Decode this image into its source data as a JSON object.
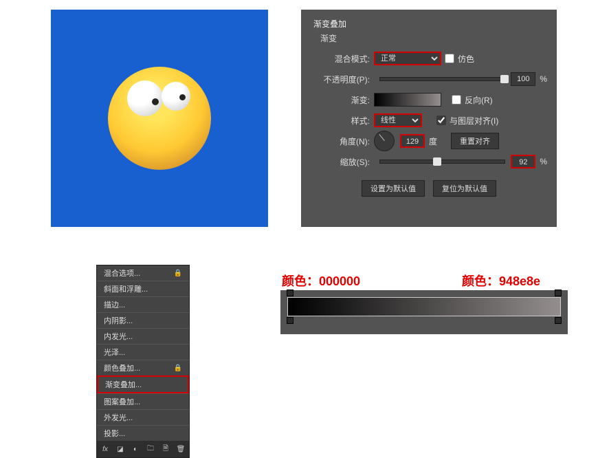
{
  "panel": {
    "title": "渐变叠加",
    "subheading": "渐变",
    "blend_label": "混合模式:",
    "blend_value": "正常",
    "dither_label": "仿色",
    "opacity_label": "不透明度(P):",
    "opacity_value": "100",
    "pct": "%",
    "gradient_label": "渐变:",
    "reverse_label": "反向(R)",
    "style_label": "样式:",
    "style_value": "线性",
    "align_label": "与图层对齐(I)",
    "angle_label": "角度(N):",
    "angle_value": "129",
    "angle_unit": "度",
    "reset_align": "重置对齐",
    "scale_label": "缩放(S):",
    "scale_value": "92",
    "btn_default": "设置为默认值",
    "btn_reset": "复位为默认值"
  },
  "fx": {
    "items": [
      "混合选项...",
      "斜面和浮雕...",
      "描边...",
      "内阴影...",
      "内发光...",
      "光泽...",
      "颜色叠加...",
      "渐变叠加...",
      "图案叠加...",
      "外发光...",
      "投影..."
    ],
    "highlight_index": 7,
    "bar_label": "fx"
  },
  "gradient_editor": {
    "color_left_label": "颜色：",
    "color_left_value": "000000",
    "color_right_label": "颜色：",
    "color_right_value": "948e8e"
  }
}
